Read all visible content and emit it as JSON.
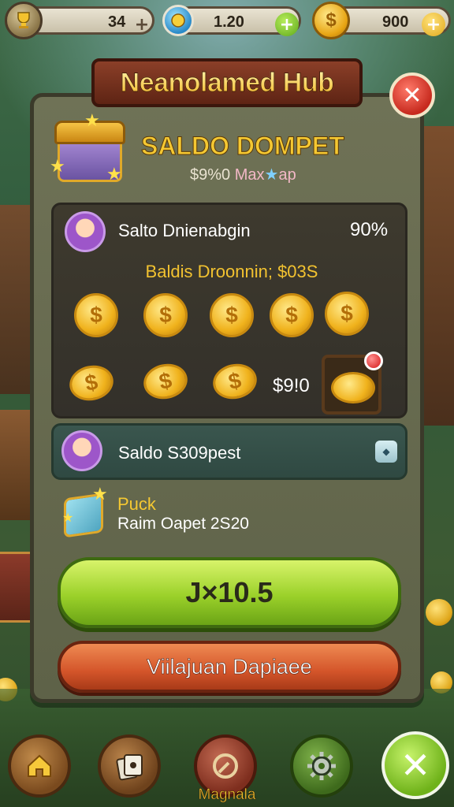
{
  "resources": [
    {
      "name": "trophy",
      "value": "34",
      "icon": "trophy-icon",
      "plus": "+"
    },
    {
      "name": "gems",
      "value": "1.20",
      "icon": "gem-icon",
      "plus": "+"
    },
    {
      "name": "coins",
      "value": "900",
      "icon": "coin-icon",
      "plus": "+"
    }
  ],
  "hub": {
    "title": "Neanolamed Hub",
    "close": "✕"
  },
  "header": {
    "title": "SALDO DOMPET",
    "sub_value": "$9%0",
    "sub_max": "Max",
    "sub_tail": "ap"
  },
  "wallet": {
    "label": "Salto Dnienabgin",
    "percent": "90%",
    "gold_line": "Baldis Droonnin; $03S",
    "coin_symbol": "$",
    "coin_label": "$9!0"
  },
  "row2": {
    "label": "Saldo S309pest",
    "button": "◆"
  },
  "puck": {
    "title": "Puck",
    "subtitle": "Raim Oapet 2S20"
  },
  "buttons": {
    "primary": "J×10.5",
    "secondary": "Viilajuan Dapiaee"
  },
  "nav": {
    "home": "⌂",
    "label": "Magnala",
    "confirm": "✕"
  },
  "colors": {
    "accent_gold": "#f5c832",
    "primary_green": "#9bd12a",
    "danger_red": "#d4552a"
  }
}
